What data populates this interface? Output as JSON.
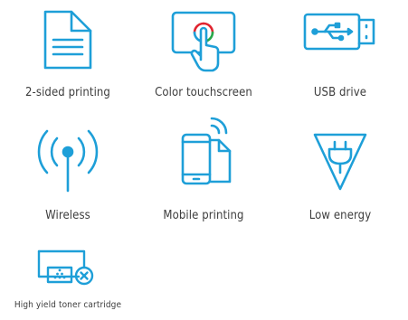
{
  "features": [
    {
      "label": "2-sided printing",
      "icon": "document-icon"
    },
    {
      "label": "Color touchscreen",
      "icon": "touchscreen-icon"
    },
    {
      "label": "USB drive",
      "icon": "usb-drive-icon"
    },
    {
      "label": "Wireless",
      "icon": "wireless-icon"
    },
    {
      "label": "Mobile printing",
      "icon": "mobile-printing-icon"
    },
    {
      "label": "Low energy",
      "icon": "low-energy-icon"
    },
    {
      "label": "High yield toner cartridge",
      "icon": "toner-cartridge-icon"
    }
  ],
  "colors": {
    "icon": "#1e9fd8",
    "label": "#3d3d3d",
    "touch_red": "#e0242f",
    "touch_green": "#27a84a",
    "touch_blue": "#1e9fd8"
  }
}
